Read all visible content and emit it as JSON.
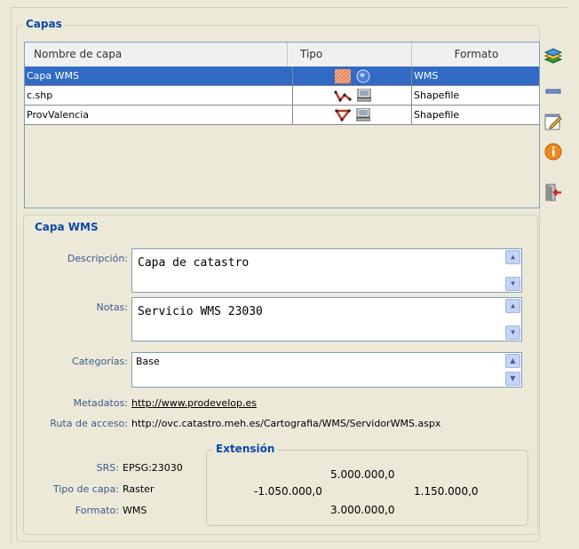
{
  "capas": {
    "title": "Capas",
    "headers": {
      "name": "Nombre de capa",
      "tipo": "Tipo",
      "formato": "Formato"
    },
    "rows": [
      {
        "name": "Capa WMS",
        "tipo_icons": [
          "raster-layer-icon",
          "globe-icon"
        ],
        "formato": "WMS",
        "selected": true
      },
      {
        "name": "c.shp",
        "tipo_icons": [
          "line-vector-icon",
          "computer-icon"
        ],
        "formato": "Shapefile",
        "selected": false
      },
      {
        "name": "ProvValencia",
        "tipo_icons": [
          "polygon-vector-icon",
          "computer-icon"
        ],
        "formato": "Shapefile",
        "selected": false
      }
    ]
  },
  "side_buttons": [
    "add-layers-icon",
    "remove-icon",
    "edit-icon",
    "info-icon",
    "exit-icon"
  ],
  "detail": {
    "title": "Capa WMS",
    "descripcion_label": "Descripción:",
    "descripcion": "Capa de catastro",
    "notas_label": "Notas:",
    "notas": "Servicio WMS 23030",
    "categorias_label": "Categorías:",
    "categorias": "Base",
    "metadatos_label": "Metadatos:",
    "metadatos": "http://www.prodevelop.es",
    "ruta_label": "Ruta de acceso:",
    "ruta": "http://ovc.catastro.meh.es/Cartografia/WMS/ServidorWMS.aspx",
    "srs_label": "SRS:",
    "srs": "EPSG:23030",
    "tipo_label": "Tipo de capa:",
    "tipo": "Raster",
    "formato_label": "Formato:",
    "formato": "WMS"
  },
  "extension": {
    "title": "Extensión",
    "top": "5.000.000,0",
    "left": "-1.050.000,0",
    "right": "1.150.000,0",
    "bottom": "3.000.000,0"
  },
  "colors": {
    "accent": "#0b4aa6",
    "selection": "#316ac5",
    "label": "#3a5a8c"
  }
}
